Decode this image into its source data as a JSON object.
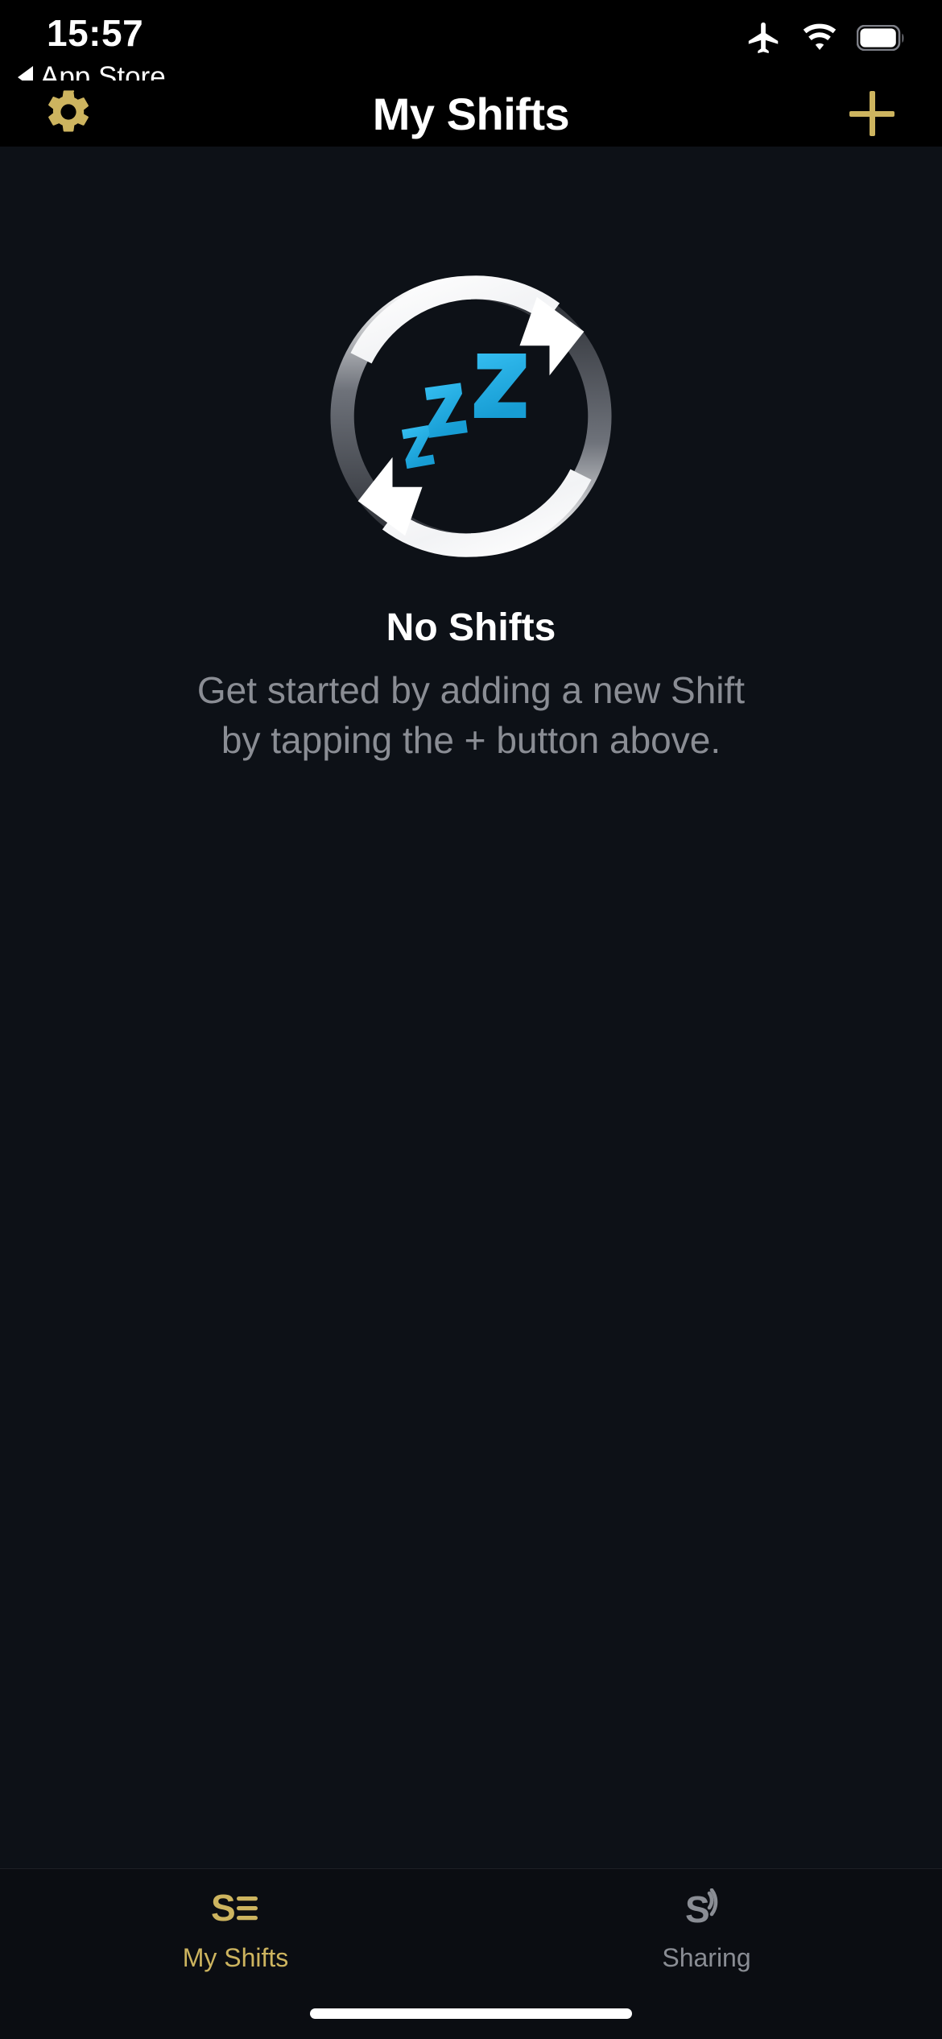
{
  "status_bar": {
    "time": "15:57",
    "back_label": "App Store",
    "back_icon": "back-triangle-icon",
    "icons": [
      "airplane-mode-icon",
      "wifi-icon",
      "battery-icon"
    ]
  },
  "nav_bar": {
    "title": "My Shifts",
    "left_icon": "gear-icon",
    "right_icon": "plus-icon",
    "accent_color": "#cdb45f"
  },
  "empty_state": {
    "illustration": "refresh-zzz-icon",
    "title": "No Shifts",
    "subtitle": "Get started by adding a new Shift by tapping the + button above."
  },
  "tab_bar": {
    "tabs": [
      {
        "label": "My Shifts",
        "icon": "shifts-list-icon",
        "active": true,
        "color": "#cdb45f"
      },
      {
        "label": "Sharing",
        "icon": "sharing-broadcast-icon",
        "active": false,
        "color": "#8a8d94"
      }
    ]
  },
  "colors": {
    "background": "#0d1117",
    "bar_background": "#000000",
    "accent_gold": "#cdb45f",
    "muted_text": "#8a8d94",
    "zzz_blue": "#2ab4e8"
  },
  "home_indicator": "home-indicator"
}
